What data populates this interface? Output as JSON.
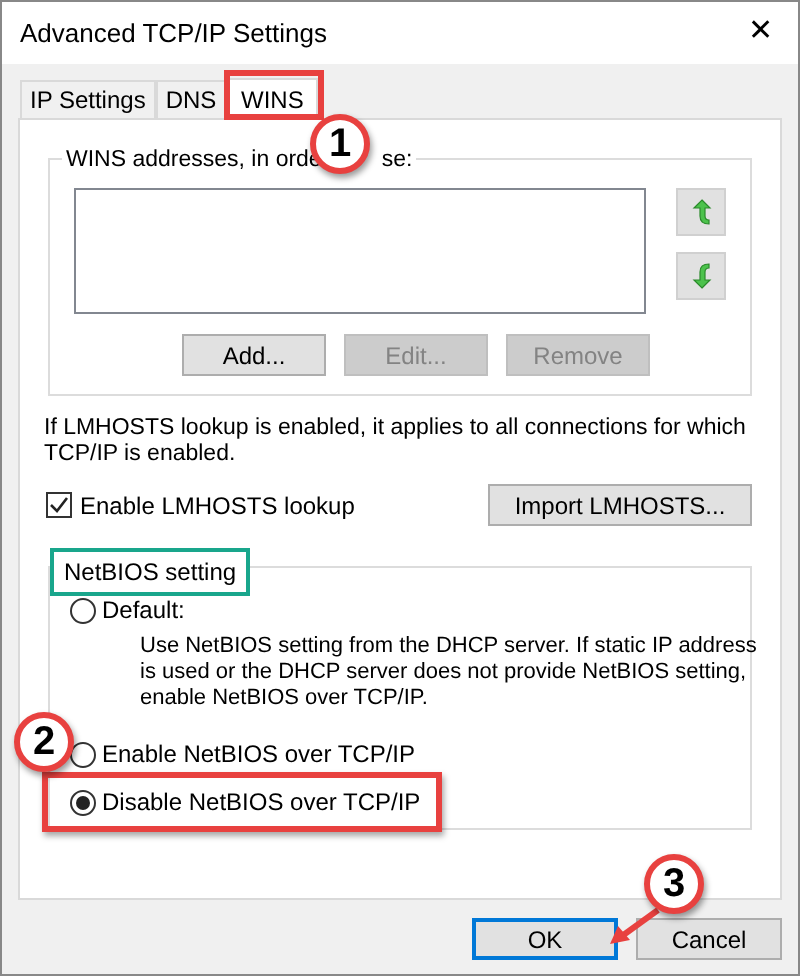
{
  "window": {
    "title": "Advanced TCP/IP Settings",
    "close": "✕"
  },
  "tabs": [
    {
      "label": "IP Settings",
      "selected": false
    },
    {
      "label": "DNS",
      "selected": false
    },
    {
      "label": "WINS",
      "selected": true
    }
  ],
  "wins_group": {
    "label_before": "WINS addresses, in orde",
    "label_after": "se:",
    "buttons": [
      {
        "label": "Add...",
        "disabled": false
      },
      {
        "label": "Edit...",
        "disabled": true
      },
      {
        "label": "Remove",
        "disabled": true
      }
    ]
  },
  "lmhosts": {
    "note": "If LMHOSTS lookup is enabled, it applies to all connections for which TCP/IP is enabled.",
    "checkbox": {
      "label": "Enable LMHOSTS lookup",
      "checked": true
    },
    "import_button": "Import LMHOSTS..."
  },
  "netbios": {
    "label": "NetBIOS setting",
    "options": [
      {
        "label": "Default:",
        "selected": false,
        "description": "Use NetBIOS setting from the DHCP server. If static IP address is used or the DHCP server does not provide NetBIOS setting, enable NetBIOS over TCP/IP."
      },
      {
        "label": "Enable NetBIOS over TCP/IP",
        "selected": false
      },
      {
        "label": "Disable NetBIOS over TCP/IP",
        "selected": true
      }
    ]
  },
  "footer": [
    {
      "label": "OK",
      "default": true
    },
    {
      "label": "Cancel",
      "default": false
    }
  ],
  "callouts": [
    "1",
    "2",
    "3"
  ]
}
